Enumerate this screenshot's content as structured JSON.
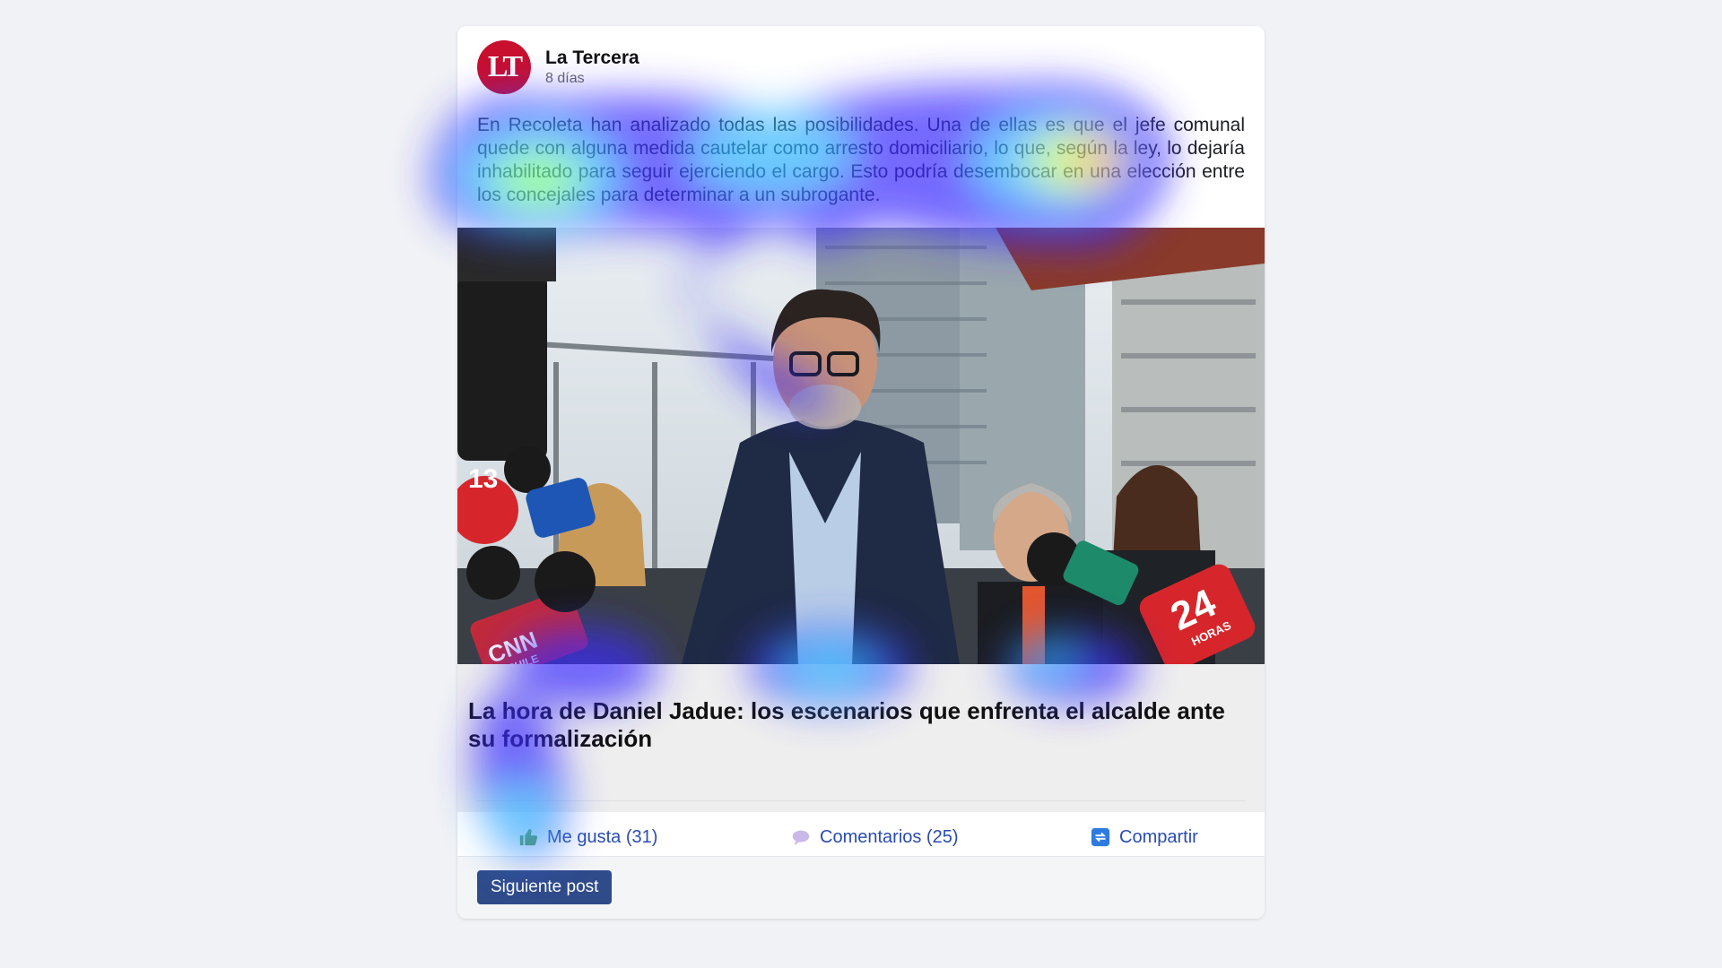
{
  "post": {
    "source_name": "La Tercera",
    "logo_text": "LT",
    "time_ago": "8 días",
    "text": "En Recoleta han analizado todas las posibilidades. Una de ellas es que el jefe comunal quede con alguna medida cautelar como arresto domiciliario, lo que, según la ley, lo dejaría inhabilitado para seguir ejerciendo el cargo. Esto podría desembocar en una elección entre los concejales para determinar a un subrogante.",
    "link_title": "La hora de Daniel Jadue: los escenarios que enfrenta el alcalde ante su formalización"
  },
  "actions": {
    "like_label": "Me gusta (31)",
    "like_icon": "thumbs-up-icon",
    "comment_label": "Comentarios (25)",
    "comment_icon": "speech-bubble-icon",
    "share_label": "Compartir",
    "share_icon": "share-icon"
  },
  "footer": {
    "next_label": "Siguiente post"
  },
  "image_overlay": {
    "mic_labels": [
      "13",
      "CNN",
      "CHILE",
      "24",
      "HORAS"
    ]
  },
  "colors": {
    "brand": "#c8102e",
    "link": "#2a4cb0",
    "button": "#2f4b8a"
  }
}
